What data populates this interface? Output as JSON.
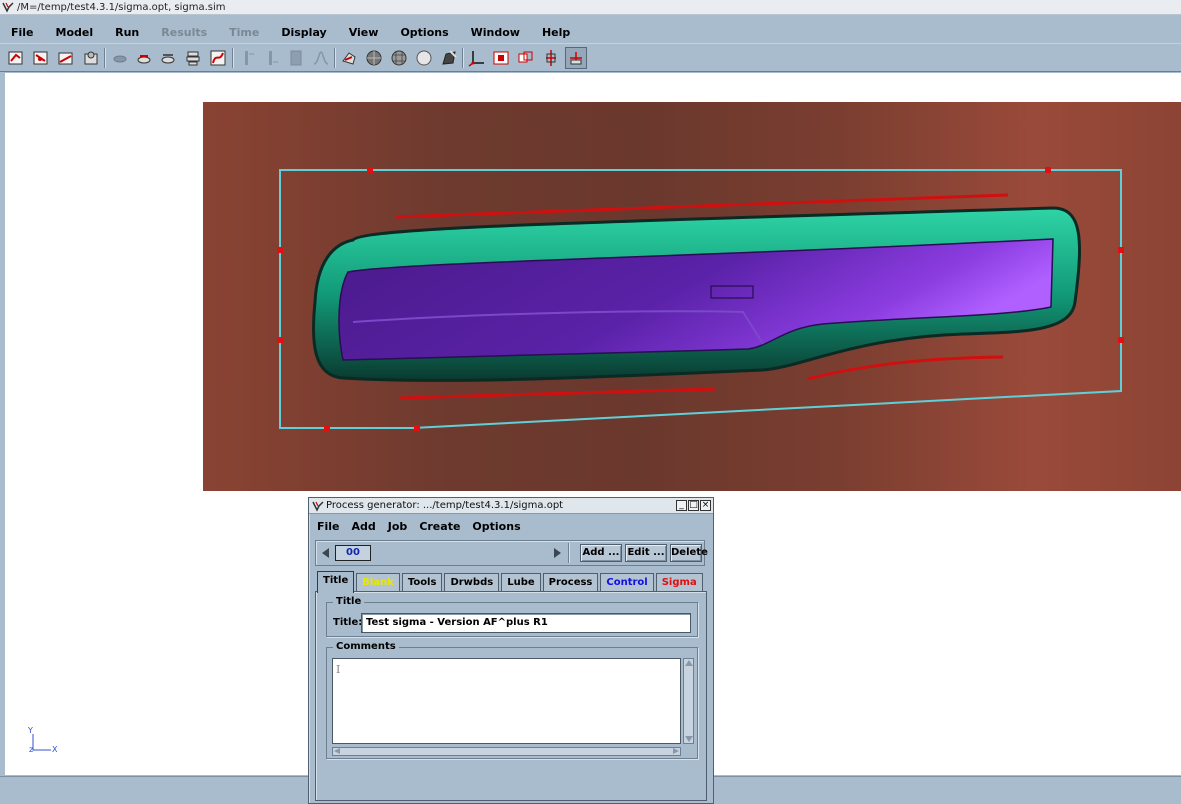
{
  "window": {
    "title": "/M=/temp/test4.3.1/sigma.opt, sigma.sim"
  },
  "menubar": {
    "items": [
      {
        "label": "File",
        "enabled": true
      },
      {
        "label": "Model",
        "enabled": true
      },
      {
        "label": "Run",
        "enabled": true
      },
      {
        "label": "Results",
        "enabled": false
      },
      {
        "label": "Time",
        "enabled": false
      },
      {
        "label": "Display",
        "enabled": true
      },
      {
        "label": "View",
        "enabled": true
      },
      {
        "label": "Options",
        "enabled": true
      },
      {
        "label": "Window",
        "enabled": true
      },
      {
        "label": "Help",
        "enabled": true
      }
    ]
  },
  "toolbar": {
    "icons": [
      "open-model-icon",
      "save-model-icon",
      "open-file-icon",
      "load-results-icon",
      "disabled-tool-icon",
      "disabled-tool-icon",
      "disabled-tool-icon",
      "stack-icon",
      "curve-icon",
      "disabled-dim-icon",
      "disabled-dim-icon",
      "disabled-dim-icon",
      "disabled-dim-icon",
      "shaded-part-icon",
      "wire-sphere-icon",
      "mesh-sphere-icon",
      "solid-sphere-icon",
      "edit-shape-icon",
      "axes-icon",
      "fit-view-icon",
      "rotate-view-icon",
      "move-view-icon",
      "select-view-icon"
    ],
    "pressed_index": 22
  },
  "viewport": {
    "colors": {
      "background": "#7a3f31",
      "boundary": "#5fd0d8",
      "handles": "#e01010",
      "drawbeads": "#d01010",
      "binder": "#1fb38a",
      "punch": "#6a2bb0"
    }
  },
  "axes": {
    "y": "Y",
    "z": "z",
    "x": "X"
  },
  "dialog": {
    "title": "Process generator: .../temp/test4.3.1/sigma.opt",
    "window_buttons": [
      "_",
      "□",
      "×"
    ],
    "menu": [
      "File",
      "Add",
      "Job",
      "Create",
      "Options"
    ],
    "step_value": "00",
    "buttons": {
      "add": "Add ...",
      "edit": "Edit ...",
      "delete": "Delete"
    },
    "tabs": [
      {
        "label": "Title",
        "color": "#000000"
      },
      {
        "label": "Blank",
        "color": "#e8e800"
      },
      {
        "label": "Tools",
        "color": "#000000"
      },
      {
        "label": "Drwbds",
        "color": "#000000"
      },
      {
        "label": "Lube",
        "color": "#000000"
      },
      {
        "label": "Process",
        "color": "#000000"
      },
      {
        "label": "Control",
        "color": "#1010e0"
      },
      {
        "label": "Sigma",
        "color": "#e01010"
      }
    ],
    "active_tab": "Title",
    "title_group": {
      "label": "Title",
      "field_label": "Title:",
      "value": "Test sigma - Version AF^plus R1"
    },
    "comments_group": {
      "label": "Comments",
      "value": ""
    }
  }
}
